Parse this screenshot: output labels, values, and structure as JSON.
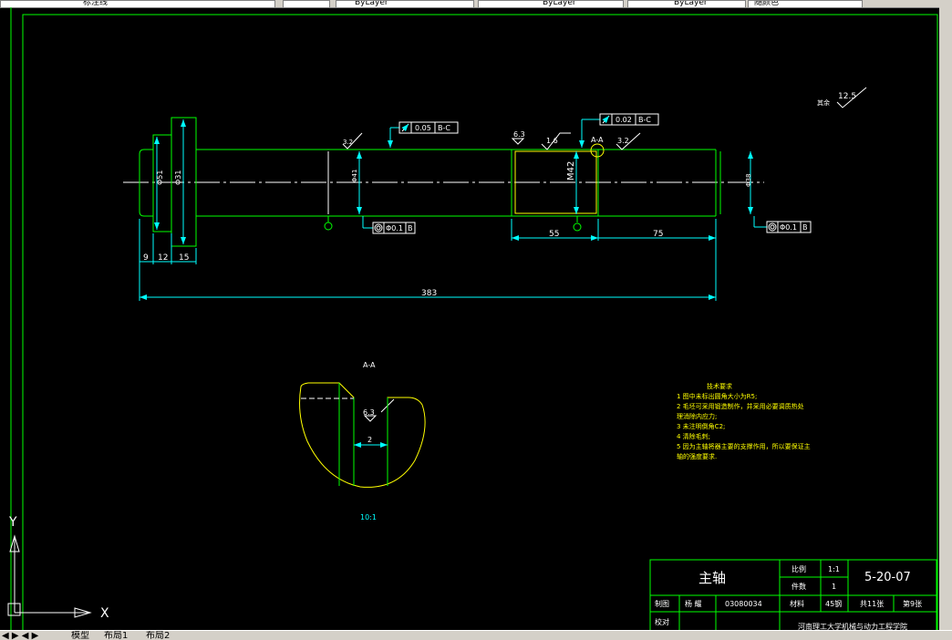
{
  "toolbar": {
    "layer_name": "标注线",
    "dd1": "ByLayer",
    "dd2": "ByLayer",
    "dd3": "ByLayer",
    "dd4": "随颜色"
  },
  "colors": {
    "background": "#000000",
    "green": "#00ff00",
    "cyan": "#00ffff",
    "yellow": "#ffff00",
    "white": "#ffffff"
  },
  "drawing": {
    "dims": {
      "d9": "9",
      "d12": "12",
      "d15": "15",
      "d383": "383",
      "d55": "55",
      "d75": "75",
      "phi_left1": "Φ51",
      "phi_left2": "Φ31",
      "phi_mid": "Φ41",
      "m42": "M42",
      "phi_right": "Φ38"
    },
    "tolerances": {
      "tol1_value": "0.05",
      "tol1_datum": "B-C",
      "tol2_value": "0.02",
      "tol2_datum": "B-C",
      "tol3_value": "Φ0.1",
      "tol3_datum": "B",
      "tol4_value": "Φ0.1",
      "tol4_datum": "B"
    },
    "roughness": {
      "r1": "3.2",
      "r2": "6.3",
      "r3": "1.6",
      "r4": "3.2",
      "rest_label": "其余",
      "rest_value": "12.5",
      "section_value": "6.3"
    },
    "section": {
      "label_top": "A-A",
      "label_marker": "A-A",
      "keyway_width": "2",
      "scale": "10:1"
    },
    "tech_requirements": {
      "title": "技术要求",
      "lines": [
        "1  图中未标出圆角大小为R5;",
        "2  毛坯可采用锻造制作，并采用必要调质热处",
        "理消除内应力;",
        "3  未注明倒角C2;",
        "4  清除毛刺;",
        "5  因为主轴将器主要的支撑作用，所以要保证主",
        "轴的强度要求."
      ]
    },
    "title_block": {
      "part_name": "主轴",
      "scale_label": "比例",
      "scale_value": "1:1",
      "qty_label": "件数",
      "qty_value": "1",
      "drawing_no": "5-20-07",
      "drawn_label": "制图",
      "drawn_name": "杨  耀",
      "student_no": "03080034",
      "material_label": "材料",
      "material_value": "45钢",
      "sheet_total": "共11张",
      "sheet_no": "第9张",
      "check_label": "校对",
      "institution": "河南理工大学机械与动力工程学院"
    },
    "ucs": {
      "x_label": "X",
      "y_label": "Y"
    }
  },
  "layout_tabs": {
    "model": "模型",
    "layout1": "布局1",
    "layout2": "布局2"
  }
}
